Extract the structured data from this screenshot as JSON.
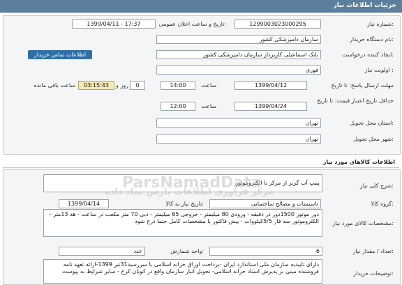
{
  "header": {
    "title": "جزئیات اطلاعات نیاز"
  },
  "fields": {
    "need_number": {
      "label": "شماره نیاز:",
      "value": "1299003023000295"
    },
    "announce_date": {
      "label": "تاریخ و ساعت اعلان عمومی:",
      "value": "1399/04/11 - 17:37"
    },
    "buyer_org": {
      "label": "نام دستگاه خریدار:",
      "value": "سازمان دامپزشکی کشور"
    },
    "creator": {
      "label": "ایجاد کننده درخواست:",
      "value": "بابک اسماعیلی کاربرداز سازمان دامپزشکی کشور",
      "link": "اطلاعات تماس خریدار"
    },
    "priority": {
      "label": "اولویت نیاز :",
      "value": "فوری"
    },
    "reply_deadline": {
      "label": "مهلت ارسال پاسخ: تا تاریخ",
      "date": "1399/04/12",
      "time_label": "ساعت",
      "time": "14:00",
      "days": "0",
      "days_label": "روز و",
      "remaining": "03:15:43",
      "remaining_label": "ساعت باقی مانده"
    },
    "price_validity": {
      "label": "حداقل تاریخ اعتبار قیمت: تا تاریخ",
      "date": "1399/04/24",
      "time_label": "ساعت",
      "time": "12:00"
    },
    "province": {
      "label": "استان محل تحویل:",
      "value": "تهران"
    },
    "city": {
      "label": "شهر محل تحویل:",
      "value": "تهران"
    }
  },
  "goods": {
    "title": "اطلاعات کالاهای مورد نیاز",
    "summary_label": "شرح کلی نیاز:",
    "summary": "پمپ آب گریز از مرکز با الکتروموتور",
    "group_label": "گروه کالا:",
    "group": "تاسیسات و مصالح ساختمانی",
    "need_date_label": "تاریخ نیاز به کالا:",
    "need_date": "1399/04/14",
    "spec_label": "مشخصات کالای مورد نیاز:",
    "spec": "دور موتور 1500دور در دقیقه - ورودی 80 میلیمتر - خروجی 65 میلیمتر - دبی 70 متر مکعب در ساعت - هد 13متر - الکتروموتور سه فاز 5/5کیلووات - پیش فاکتور با مشخصات کامل حتما درج شود",
    "qty_label": "تعداد / مقدار نیاز:",
    "qty": "6",
    "unit_label": "واحد شمارش:",
    "unit": "عدد",
    "notes_label": "توضیحات خریدار:",
    "notes": "دارای تاییدیه سازمان ملی استاندارد ایران -پرداخت اوراق خزانه اسلامی با سررسید31تیر 1399-ارائه تعهد نامه فروشنده مبنی بر پذیرش اسناد خزانه اسلامی- تحویل انبار سازمان واقع در اتوبان کرج - سایر شرایط به پیوست"
  },
  "watermark": {
    "text": "ParsNamadData",
    "sub": "مرکز فراوری اطلاعات پارس نماد داده"
  }
}
